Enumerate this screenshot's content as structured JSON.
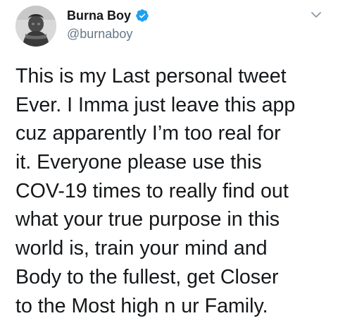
{
  "author": {
    "display_name": "Burna Boy",
    "handle": "@burnaboy",
    "verified": true,
    "avatar_icon": "profile-photo"
  },
  "menu": {
    "icon": "chevron-down-icon"
  },
  "tweet": {
    "lines": [
      "This is my Last personal tweet",
      "Ever. I Imma just leave this app",
      "cuz apparently I’m too real for",
      "it.  Everyone please use this",
      "COV-19 times to really find out",
      "what your true purpose in this",
      "world is, train your mind and",
      "Body to the fullest, get Closer",
      "to the Most high n ur Family."
    ]
  },
  "colors": {
    "text": "#14171a",
    "secondary": "#657786",
    "verified_blue": "#1da1f2",
    "chevron": "#8899a6"
  }
}
